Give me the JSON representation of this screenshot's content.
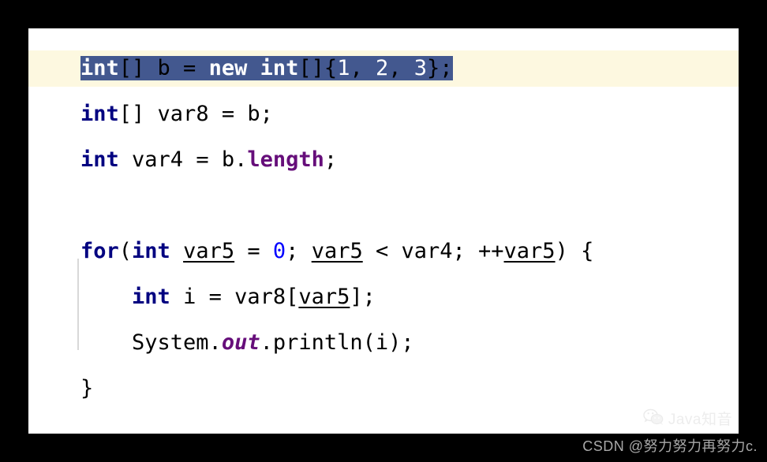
{
  "editor": {
    "language": "java",
    "colors": {
      "background": "#ffffff",
      "frame": "#000000",
      "caret_line": "#fdf8e0",
      "selection": "#43588f",
      "selection_text": "#ffffff",
      "keyword": "#000080",
      "number": "#0000ff",
      "field": "#660e7a",
      "static_member": "#660e7a",
      "default_text": "#000000",
      "indent_guide": "#d8d8d8"
    },
    "lines": [
      {
        "index": 0,
        "selected": true,
        "indent": 0,
        "text": "int[] b = new int[]{1, 2, 3};",
        "tokens": [
          {
            "t": "int",
            "k": "keyword"
          },
          {
            "t": "[] b = ",
            "k": "plain"
          },
          {
            "t": "new",
            "k": "keyword"
          },
          {
            "t": " ",
            "k": "plain"
          },
          {
            "t": "int",
            "k": "keyword"
          },
          {
            "t": "[]{",
            "k": "plain"
          },
          {
            "t": "1",
            "k": "number"
          },
          {
            "t": ", ",
            "k": "plain"
          },
          {
            "t": "2",
            "k": "number"
          },
          {
            "t": ", ",
            "k": "plain"
          },
          {
            "t": "3",
            "k": "number"
          },
          {
            "t": "};",
            "k": "plain"
          }
        ]
      },
      {
        "index": 1,
        "selected": false,
        "indent": 0,
        "text": "int[] var8 = b;",
        "tokens": [
          {
            "t": "int",
            "k": "keyword"
          },
          {
            "t": "[] var8 = b;",
            "k": "plain"
          }
        ]
      },
      {
        "index": 2,
        "selected": false,
        "indent": 0,
        "text": "int var4 = b.length;",
        "tokens": [
          {
            "t": "int",
            "k": "keyword"
          },
          {
            "t": " var4 = b.",
            "k": "plain"
          },
          {
            "t": "length",
            "k": "field"
          },
          {
            "t": ";",
            "k": "plain"
          }
        ]
      },
      {
        "index": 3,
        "selected": false,
        "indent": 0,
        "text": "",
        "tokens": []
      },
      {
        "index": 4,
        "selected": false,
        "indent": 0,
        "text": "for(int var5 = 0; var5 < var4; ++var5) {",
        "tokens": [
          {
            "t": "for",
            "k": "keyword"
          },
          {
            "t": "(",
            "k": "plain"
          },
          {
            "t": "int",
            "k": "keyword"
          },
          {
            "t": " ",
            "k": "plain"
          },
          {
            "t": "var5",
            "k": "localvar"
          },
          {
            "t": " = ",
            "k": "plain"
          },
          {
            "t": "0",
            "k": "number"
          },
          {
            "t": "; ",
            "k": "plain"
          },
          {
            "t": "var5",
            "k": "localvar"
          },
          {
            "t": " < var4; ++",
            "k": "plain"
          },
          {
            "t": "var5",
            "k": "localvar"
          },
          {
            "t": ") {",
            "k": "plain"
          }
        ]
      },
      {
        "index": 5,
        "selected": false,
        "indent": 1,
        "text": "    int i = var8[var5];",
        "tokens": [
          {
            "t": "    ",
            "k": "plain"
          },
          {
            "t": "int",
            "k": "keyword"
          },
          {
            "t": " i = var8[",
            "k": "plain"
          },
          {
            "t": "var5",
            "k": "localvar"
          },
          {
            "t": "];",
            "k": "plain"
          }
        ]
      },
      {
        "index": 6,
        "selected": false,
        "indent": 1,
        "text": "    System.out.println(i);",
        "tokens": [
          {
            "t": "    System.",
            "k": "plain"
          },
          {
            "t": "out",
            "k": "static"
          },
          {
            "t": ".println(i);",
            "k": "plain"
          }
        ]
      },
      {
        "index": 7,
        "selected": false,
        "indent": 0,
        "text": "}",
        "tokens": [
          {
            "t": "}",
            "k": "plain"
          }
        ]
      }
    ]
  },
  "watermark": {
    "icon": "wechat-icon",
    "label": "Java知音"
  },
  "footer": {
    "text": "CSDN @努力努力再努力c."
  }
}
